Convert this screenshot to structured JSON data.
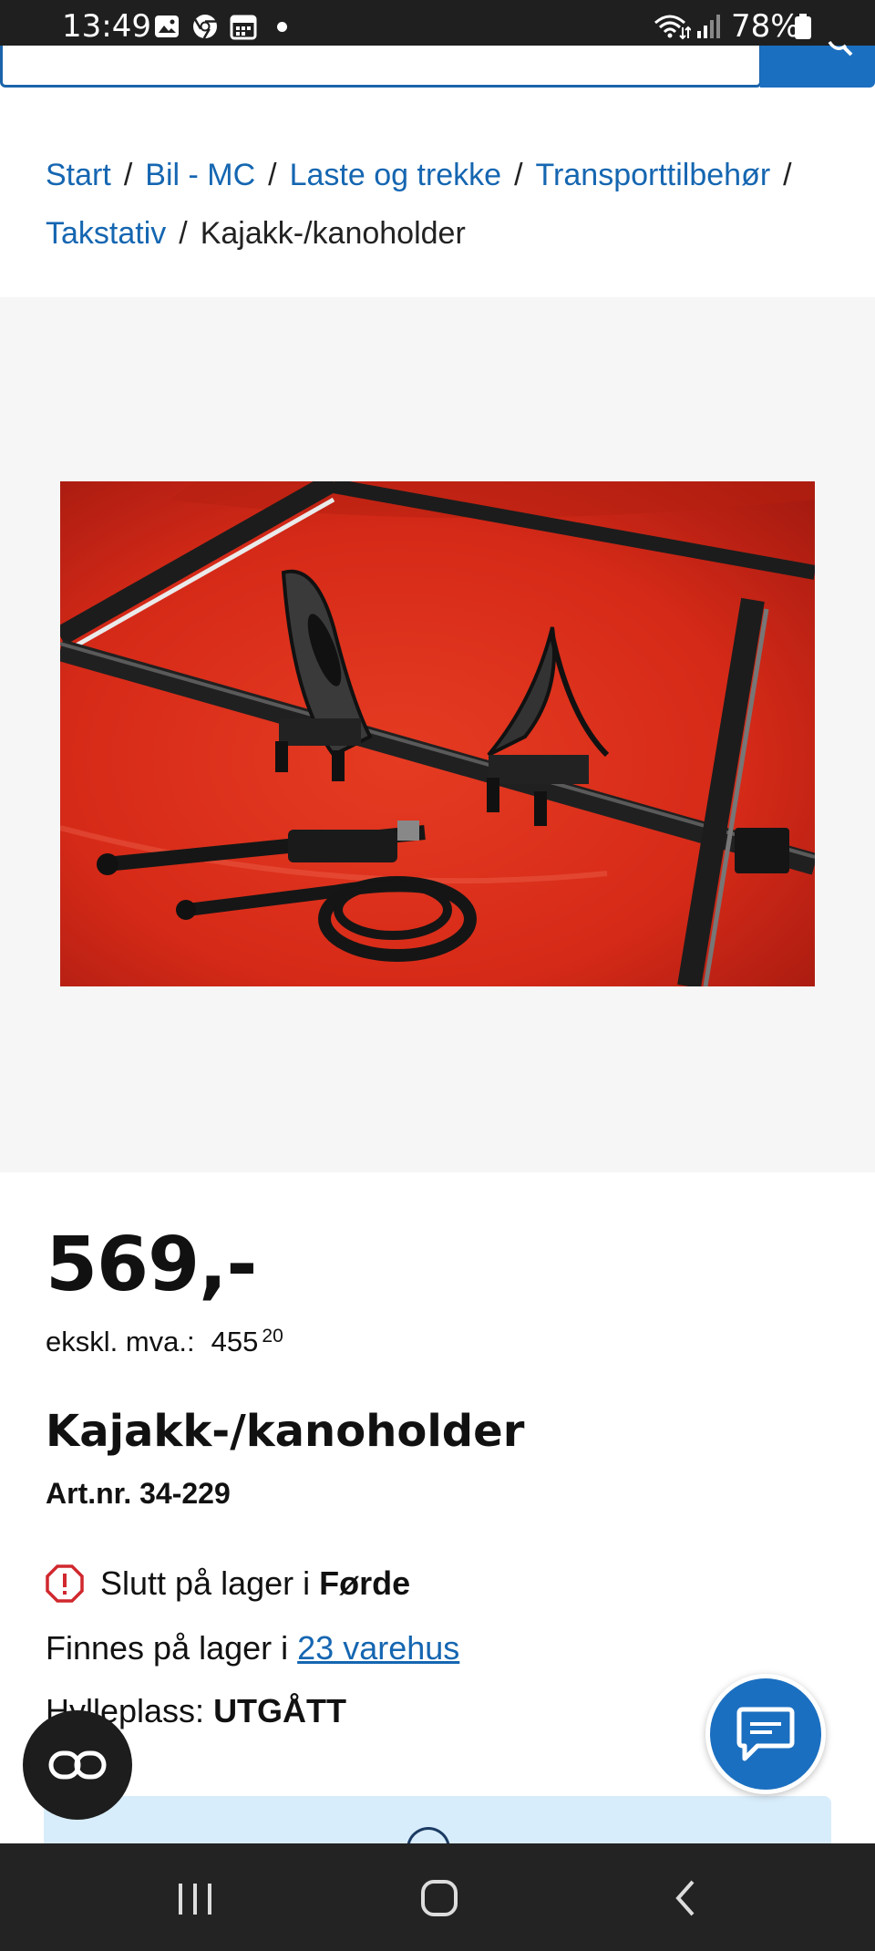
{
  "status_bar": {
    "time": "13:49",
    "battery": "78%",
    "icons": [
      "image-icon",
      "chrome-icon",
      "calendar-icon",
      "dot-icon",
      "wifi-icon",
      "signal-icon",
      "battery-icon"
    ]
  },
  "breadcrumb": {
    "items": [
      "Start",
      "Bil - MC",
      "Laste og trekke",
      "Transporttilbehør",
      "Takstativ"
    ],
    "separator": "/",
    "current": "Kajakk-/kanoholder"
  },
  "product": {
    "image_alt": "Kajakk-/kanoholder",
    "price": "569,-",
    "exvat_label": "ekskl. mva.:",
    "exvat_main": "455",
    "exvat_cents": "20",
    "title": "Kajakk-/kanoholder",
    "art_nr": "Art.nr. 34-229"
  },
  "stock": {
    "out_prefix": "Slutt på lager i ",
    "out_store": "Førde",
    "available_prefix": "Finnes på lager i ",
    "available_link": "23 varehus",
    "shelf_label": "Hylleplass: ",
    "shelf_value": "UTGÅTT"
  },
  "colors": {
    "link": "#1566b1",
    "accent": "#1b6fc0",
    "warning": "#d0282e",
    "panel": "#d8edfb"
  }
}
